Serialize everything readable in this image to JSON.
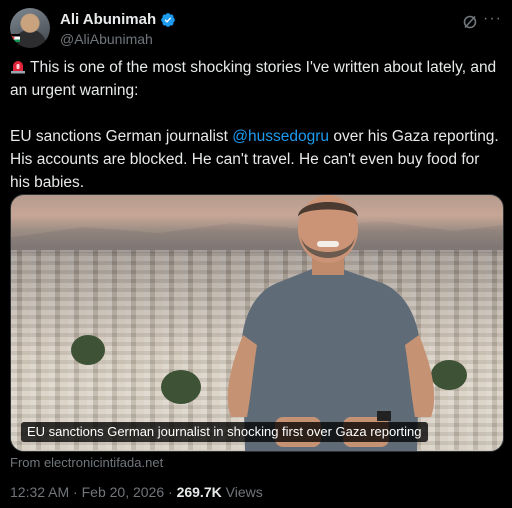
{
  "author": {
    "display_name": "Ali Abunimah",
    "handle": "@AliAbunimah",
    "verified": true
  },
  "icons": {
    "verified": "verified-badge-icon",
    "grok": "grok-icon",
    "more": "more-icon",
    "siren": "siren-emoji-icon"
  },
  "tweet": {
    "line1_text": "This is one of the most shocking stories I've written about lately, and an urgent warning:",
    "line2_before": "EU sanctions German journalist ",
    "line2_mention": "@hussedogru",
    "line2_after": " over his Gaza reporting. His accounts are blocked. He can't travel. He can't even buy food for his babies."
  },
  "media": {
    "caption": "EU sanctions German journalist in shocking first over Gaza reporting",
    "source": "From electronicintifada.net"
  },
  "meta": {
    "time": "12:32 AM",
    "date": "Feb 20, 2026",
    "views_count": "269.7K",
    "views_label": "Views"
  },
  "colors": {
    "background": "#000000",
    "text": "#e7e9ea",
    "muted": "#71767b",
    "link": "#1d9bf0",
    "verified": "#1d9bf0"
  }
}
